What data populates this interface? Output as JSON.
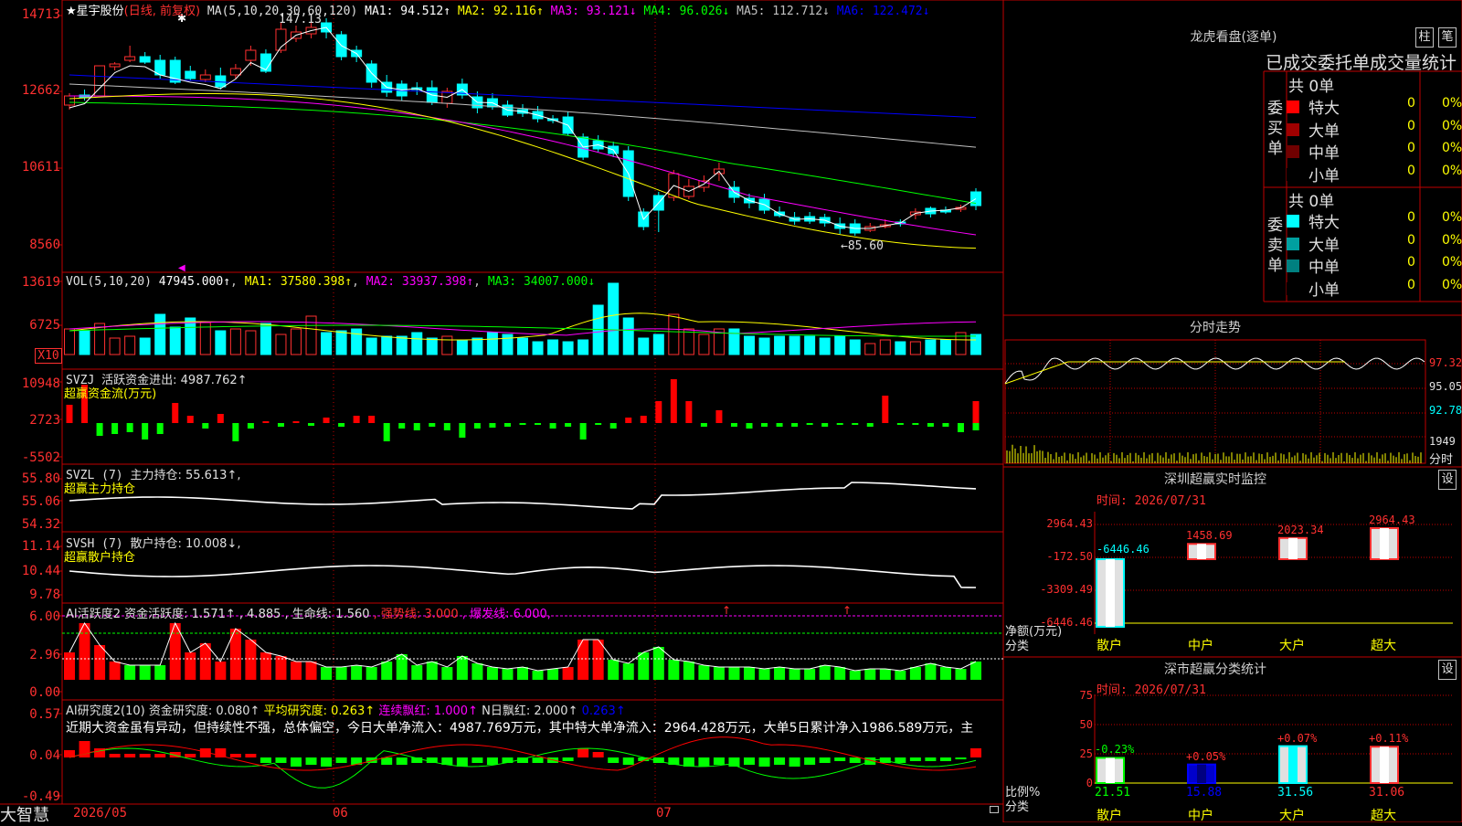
{
  "app": {
    "brand": "大智慧",
    "stock_name": "星宇股份",
    "chart_mode": "(日线, 前复权)"
  },
  "main": {
    "ma_header": "MA(5,10,20,30,60,120)",
    "ma_values": [
      {
        "label": "MA1: 94.512↑",
        "color": "#ffffff"
      },
      {
        "label": "MA2: 92.116↑",
        "color": "#ffff00"
      },
      {
        "label": "MA3: 93.121↓",
        "color": "#ff00ff"
      },
      {
        "label": "MA4: 96.026↓",
        "color": "#00ff00"
      },
      {
        "label": "MA5: 112.712↓",
        "color": "#c0c0c0"
      },
      {
        "label": "MA6: 122.472↓",
        "color": "#0000ff"
      }
    ],
    "y_ticks": [
      "14713",
      "12662",
      "10611",
      "8560"
    ],
    "high_label": "147.13",
    "low_label": "←85.60"
  },
  "volume": {
    "header": "VOL(5,10,20)",
    "value": "47945.000↑",
    "ma1": "MA1: 37580.398↑",
    "ma2": "MA2: 33937.398↑",
    "ma3": "MA3: 34007.000↓",
    "y_ticks": [
      "13619",
      "6725"
    ],
    "unit": "X10"
  },
  "svzj": {
    "title": "SVZJ",
    "label": "活跃资金进出: 4987.762↑",
    "sub": "超赢资金流(万元)",
    "y_ticks": [
      "10948",
      "2723",
      "-5502"
    ]
  },
  "svzl": {
    "title": "SVZL (7)",
    "label": "主力持仓: 55.613↑,",
    "sub": "超赢主力持仓",
    "y_ticks": [
      "55.80",
      "55.06",
      "54.32"
    ]
  },
  "svsh": {
    "title": "SVSH (7)",
    "label": "散户持仓: 10.008↓,",
    "sub": "超赢散户持仓",
    "y_ticks": [
      "11.14",
      "10.44",
      "9.78"
    ]
  },
  "ai_active": {
    "title": "AI活跃度2",
    "items": [
      {
        "label": "资金活跃度: 1.571↑",
        "color": "#e0e0e0"
      },
      {
        "label": ", 4.885",
        "color": "#e0e0e0"
      },
      {
        "label": ", 生命线: 1.560",
        "color": "#e0e0e0"
      },
      {
        "label": ", 强势线: 3.000",
        "color": "#ff3030"
      },
      {
        "label": ", 爆发线: 6.000,",
        "color": "#ff00ff"
      }
    ],
    "y_ticks": [
      "6.00",
      "2.96",
      "0.00"
    ]
  },
  "ai_research": {
    "title": "AI研究度2(10)",
    "items": [
      {
        "label": "资金研究度: 0.080↑",
        "color": "#e0e0e0"
      },
      {
        "label": "平均研究度: 0.263↑",
        "color": "#ffff00"
      },
      {
        "label": "连续飘红: 1.000↑",
        "color": "#ff00ff"
      },
      {
        "label": "N日飘红: 2.000↑",
        "color": "#e0e0e0"
      },
      {
        "label": "0.263↑",
        "color": "#0000ff"
      }
    ],
    "comment": "近期大资金虽有异动，但持续性不强，总体偏空，今日大单净流入：4987.769万元，其中特大单净流入：2964.428万元，大单5日累计净入1986.589万元，主",
    "y_ticks": [
      "0.57",
      "0.04",
      "-0.49"
    ]
  },
  "x_axis": {
    "labels": [
      "2026/05",
      "06",
      "07"
    ]
  },
  "lhb": {
    "title": "龙虎看盘(逐单)",
    "btn_col": "柱",
    "btn_pen": "笔",
    "subtitle": "已成交委托单成交量统计",
    "buy": {
      "side_label": "委买单",
      "total": "共 0单",
      "rows": [
        {
          "name": "特大",
          "color": "#ff0000",
          "v1": "0",
          "v2": "0%"
        },
        {
          "name": "大单",
          "color": "#a00000",
          "v1": "0",
          "v2": "0%"
        },
        {
          "name": "中单",
          "color": "#700000",
          "v1": "0",
          "v2": "0%"
        },
        {
          "name": "小单",
          "color": "#000000",
          "v1": "0",
          "v2": "0%"
        }
      ]
    },
    "sell": {
      "side_label": "委卖单",
      "total": "共 0单",
      "rows": [
        {
          "name": "特大",
          "color": "#00ffff",
          "v1": "0",
          "v2": "0%"
        },
        {
          "name": "大单",
          "color": "#00a0a0",
          "v1": "0",
          "v2": "0%"
        },
        {
          "name": "中单",
          "color": "#008080",
          "v1": "0",
          "v2": "0%"
        },
        {
          "name": "小单",
          "color": "#000000",
          "v1": "0",
          "v2": "0%"
        }
      ]
    }
  },
  "intraday": {
    "title": "分时走势",
    "prices": [
      "97.32",
      "95.05",
      "92.78"
    ],
    "vol_label": "1949",
    "vol_sub": "分时"
  },
  "sz_monitor": {
    "title": "深圳超赢实时监控",
    "btn": "设",
    "time": "时间: 2026/07/31",
    "y_ticks": [
      "2964.43",
      "-172.50",
      "-3309.49",
      "-6446.46"
    ],
    "y_label": "净额(万元)",
    "x_label": "分类",
    "categories": [
      "散户",
      "中户",
      "大户",
      "超大"
    ],
    "values": [
      "-6446.46",
      "1458.69",
      "2023.34",
      "2964.43"
    ]
  },
  "sz_class": {
    "title": "深市超赢分类统计",
    "btn": "设",
    "time": "时间: 2026/07/31",
    "y_ticks": [
      "75",
      "50",
      "25",
      "0"
    ],
    "y_label": "比例%",
    "x_label": "分类",
    "categories": [
      "散户",
      "中户",
      "大户",
      "超大"
    ],
    "top_labels": [
      "-0.23%",
      "+0.05%",
      "+0.07%",
      "+0.11%"
    ],
    "values": [
      "21.51",
      "15.88",
      "31.56",
      "31.06"
    ]
  }
}
